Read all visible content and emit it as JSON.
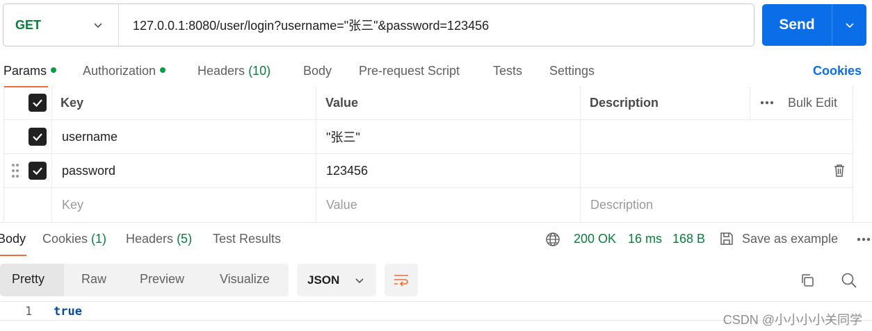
{
  "request": {
    "method": "GET",
    "url": "127.0.0.1:8080/user/login?username=\"张三\"&password=123456",
    "send_label": "Send"
  },
  "request_tabs": {
    "params": "Params",
    "authorization": "Authorization",
    "headers": "Headers",
    "headers_count": "(10)",
    "body": "Body",
    "pre_request": "Pre-request Script",
    "tests": "Tests",
    "settings": "Settings",
    "cookies": "Cookies"
  },
  "params_table": {
    "columns": {
      "key": "Key",
      "value": "Value",
      "description": "Description"
    },
    "bulk_edit": "Bulk Edit",
    "rows": [
      {
        "key": "username",
        "value": "\"张三\"",
        "description": ""
      },
      {
        "key": "password",
        "value": "123456",
        "description": ""
      }
    ],
    "placeholder": {
      "key": "Key",
      "value": "Value",
      "description": "Description"
    }
  },
  "response": {
    "tabs": {
      "body": "Body",
      "cookies": "Cookies",
      "cookies_count": "(1)",
      "headers": "Headers",
      "headers_count": "(5)",
      "test_results": "Test Results"
    },
    "status": "200 OK",
    "time": "16 ms",
    "size": "168 B",
    "save_example": "Save as example",
    "views": {
      "pretty": "Pretty",
      "raw": "Raw",
      "preview": "Preview",
      "visualize": "Visualize"
    },
    "format": "JSON",
    "line_number": "1",
    "body_text": "true"
  },
  "watermark": "CSDN @小小小小关同学",
  "colors": {
    "accent": "#0a6ee8",
    "method_green": "#0a7d3b",
    "tab_underline": "#f26b3a"
  }
}
